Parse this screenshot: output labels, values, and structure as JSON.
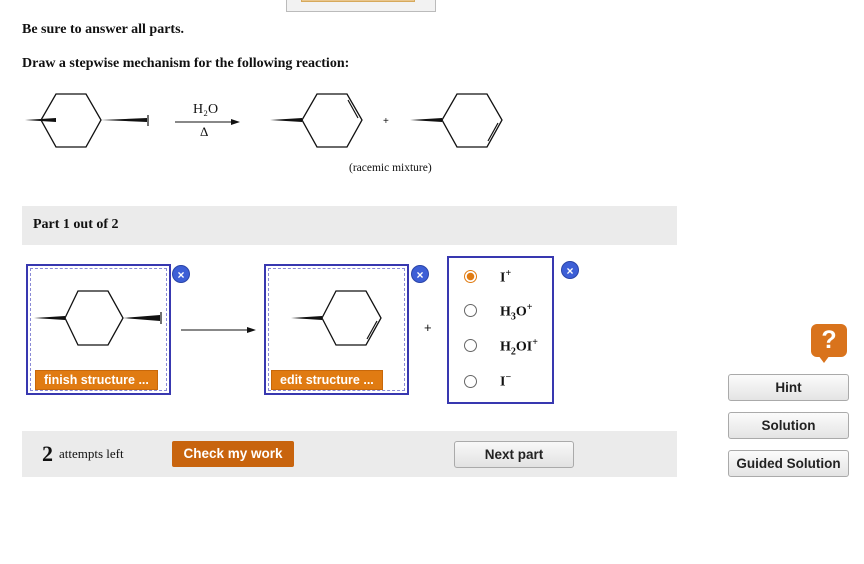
{
  "instructions": {
    "line1": "Be sure to answer all parts.",
    "line2": "Draw a stepwise mechanism for the following reaction:"
  },
  "reaction": {
    "reagent": "H₂O",
    "condition": "Δ",
    "plus": "+",
    "note": "(racemic mixture)"
  },
  "part": {
    "label": "Part 1 out of 2"
  },
  "workspace": {
    "box1_button": "finish structure ...",
    "box2_button": "edit structure ...",
    "plus": "+",
    "close_symbol": "×"
  },
  "choices": {
    "selected_index": 0,
    "options": [
      {
        "main": "I",
        "sub": "",
        "mid": "",
        "sup": "+"
      },
      {
        "main": "H",
        "sub": "3",
        "mid": "O",
        "sup": "+"
      },
      {
        "main": "H",
        "sub": "2",
        "mid": "OI",
        "sup": "+"
      },
      {
        "main": "I",
        "sub": "",
        "mid": "",
        "sup": "−"
      }
    ]
  },
  "footer": {
    "attempts_count": "2",
    "attempts_label": "attempts left",
    "check_button": "Check my work",
    "next_button": "Next part"
  },
  "sidebar": {
    "help_symbol": "?",
    "hint": "Hint",
    "solution": "Solution",
    "guided_solution": "Guided Solution"
  }
}
